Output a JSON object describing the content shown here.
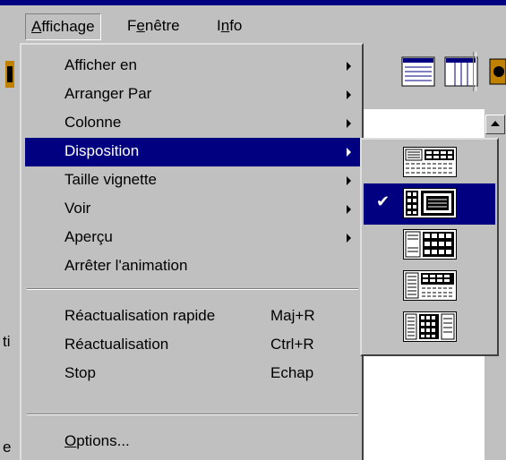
{
  "menubar": {
    "items": [
      {
        "label_pre": "",
        "label_u": "A",
        "label_post": "ffichage",
        "active": true
      },
      {
        "label_pre": "F",
        "label_u": "e",
        "label_post": "nêtre",
        "active": false
      },
      {
        "label_pre": "I",
        "label_u": "n",
        "label_post": "fo",
        "active": false
      }
    ]
  },
  "background": {
    "cutoff_left_1": "ti",
    "cutoff_left_2": "e"
  },
  "menu": {
    "items": [
      {
        "label": "Afficher en",
        "submenu": true
      },
      {
        "label": "Arranger Par",
        "submenu": true
      },
      {
        "label": "Colonne",
        "submenu": true
      },
      {
        "label": "Disposition",
        "submenu": true,
        "highlighted": true
      },
      {
        "label": "Taille vignette",
        "submenu": true
      },
      {
        "label": "Voir",
        "submenu": true
      },
      {
        "label": "Aperçu",
        "submenu": true
      },
      {
        "label": "Arrêter l'animation",
        "submenu": false
      }
    ],
    "items2": [
      {
        "label": "Réactualisation rapide",
        "shortcut": "Maj+R"
      },
      {
        "label": "Réactualisation",
        "shortcut": "Ctrl+R"
      },
      {
        "label": "Stop",
        "shortcut": "Echap"
      }
    ],
    "options": {
      "label_u": "O",
      "label_post": "ptions..."
    }
  },
  "submenu": {
    "checkmark": "✔",
    "selected_index": 1,
    "items": [
      {
        "icon": "layout-thumbs-top-list-bottom-icon"
      },
      {
        "icon": "layout-thumbs-left-preview-right-icon"
      },
      {
        "icon": "layout-list-left-thumbs-right-icon"
      },
      {
        "icon": "layout-list-left-thumbs-preview-right-icon"
      },
      {
        "icon": "layout-list-thumbs-list-icon"
      }
    ]
  },
  "colors": {
    "highlight": "#000080",
    "face": "#c0c0c0"
  }
}
